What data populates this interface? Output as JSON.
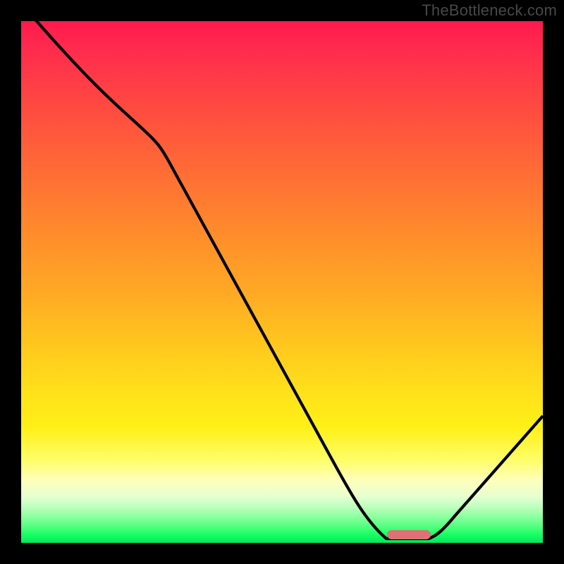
{
  "watermark": "TheBottleneck.com",
  "chart_data": {
    "type": "line",
    "title": "",
    "xlabel": "",
    "ylabel": "",
    "xlim": [
      0,
      100
    ],
    "ylim": [
      0,
      100
    ],
    "x": [
      0,
      3,
      21,
      25,
      60,
      70,
      78,
      82,
      100
    ],
    "values": [
      105,
      100,
      82,
      78,
      17,
      1,
      0,
      1,
      23
    ],
    "marker": {
      "x_start": 70,
      "x_end": 78,
      "y": 0.5
    },
    "gradient_stops": [
      {
        "pct": 0,
        "color": "#ff1a4d"
      },
      {
        "pct": 50,
        "color": "#ffb020"
      },
      {
        "pct": 80,
        "color": "#fff018"
      },
      {
        "pct": 100,
        "color": "#00e85a"
      }
    ]
  }
}
